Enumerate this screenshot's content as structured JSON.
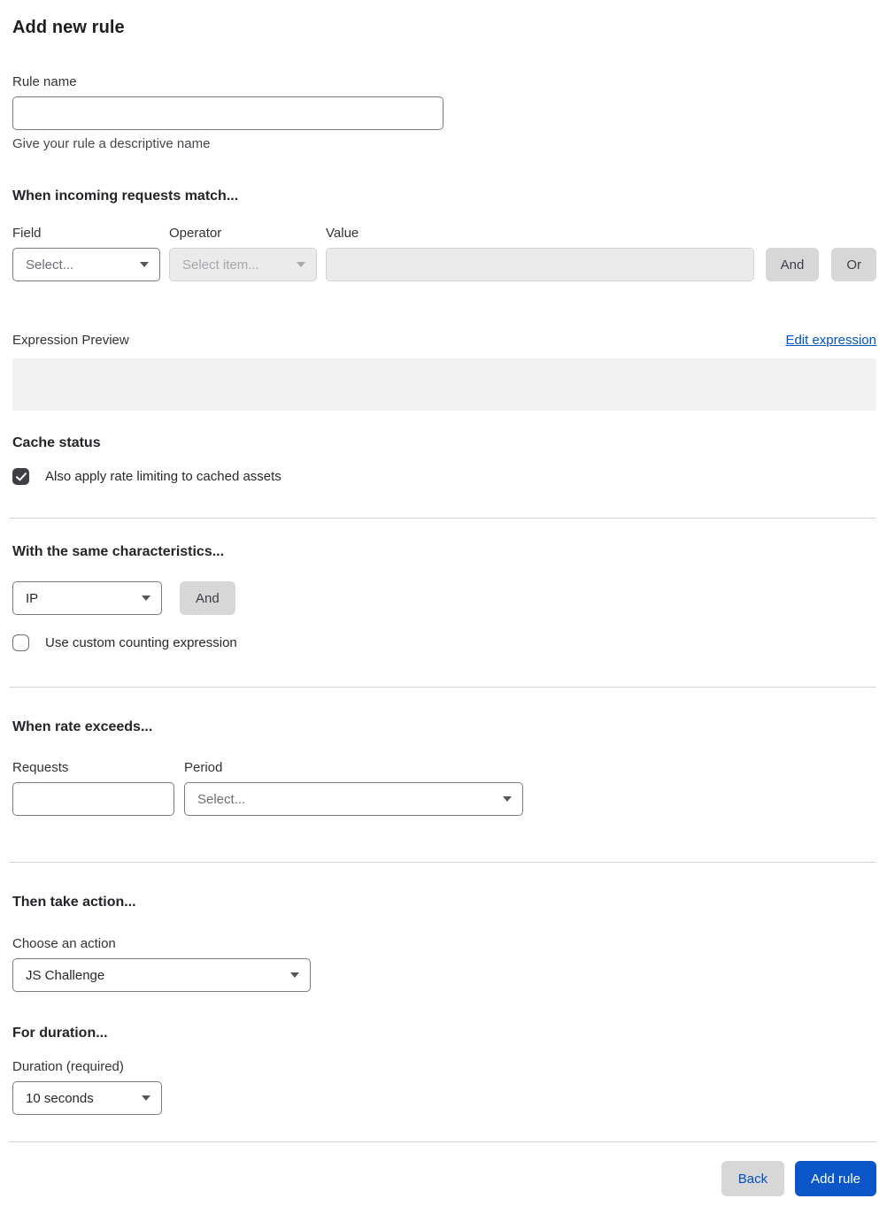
{
  "page": {
    "title": "Add new rule"
  },
  "rule_name": {
    "label": "Rule name",
    "value": "",
    "helper": "Give your rule a descriptive name"
  },
  "match_section": {
    "heading": "When incoming requests match...",
    "field": {
      "label": "Field",
      "placeholder": "Select..."
    },
    "operator": {
      "label": "Operator",
      "placeholder": "Select item..."
    },
    "value": {
      "label": "Value",
      "value": ""
    },
    "and_button": "And",
    "or_button": "Or"
  },
  "expression": {
    "preview_label": "Expression Preview",
    "edit_link": "Edit expression",
    "preview_value": ""
  },
  "cache_status": {
    "heading": "Cache status",
    "checkbox_label": "Also apply rate limiting to cached assets",
    "checked": true
  },
  "characteristics": {
    "heading": "With the same characteristics...",
    "selected": "IP",
    "and_button": "And",
    "custom_counting_label": "Use custom counting expression",
    "custom_counting_checked": false
  },
  "rate": {
    "heading": "When rate exceeds...",
    "requests_label": "Requests",
    "requests_value": "",
    "period_label": "Period",
    "period_placeholder": "Select..."
  },
  "action": {
    "heading": "Then take action...",
    "label": "Choose an action",
    "selected": "JS Challenge"
  },
  "duration": {
    "heading": "For duration...",
    "label": "Duration (required)",
    "selected": "10 seconds"
  },
  "footer": {
    "back_button": "Back",
    "add_rule_button": "Add rule"
  },
  "colors": {
    "accent_blue": "#0b57c9",
    "link_blue": "#0051c3",
    "button_gray": "#d7d7d8",
    "disabled_bg": "#ebebec",
    "preview_bg": "#f1f1f2",
    "checkbox_dark": "#3d3f43"
  }
}
